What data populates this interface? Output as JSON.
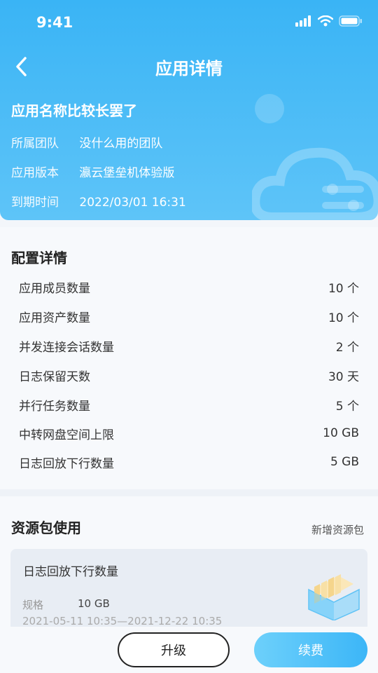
{
  "status_bar": {
    "time": "9:41"
  },
  "nav": {
    "title": "应用详情"
  },
  "app": {
    "name": "应用名称比较长罢了",
    "team_label": "所属团队",
    "team_value": "没什么用的团队",
    "version_label": "应用版本",
    "version_value": "瀛云堡垒机体验版",
    "expire_label": "到期时间",
    "expire_value": "2022/03/01 16:31"
  },
  "config": {
    "title": "配置详情",
    "rows": [
      {
        "label": "应用成员数量",
        "value": "10 个"
      },
      {
        "label": "应用资产数量",
        "value": "10 个"
      },
      {
        "label": "并发连接会话数量",
        "value": "2 个"
      },
      {
        "label": "日志保留天数",
        "value": "30 天"
      },
      {
        "label": "并行任务数量",
        "value": "5 个"
      },
      {
        "label": "中转网盘空间上限",
        "value": "10 GB"
      },
      {
        "label": "日志回放下行数量",
        "value": "5 GB"
      }
    ]
  },
  "resources": {
    "title": "资源包使用",
    "add_label": "新增资源包",
    "card": {
      "title": "日志回放下行数量",
      "spec_label": "规格",
      "spec_value": "10 GB",
      "dates": "2021-05-11 10:35—2021-12-22 10:35"
    }
  },
  "actions": {
    "upgrade_label": "升级",
    "renew_label": "续费"
  },
  "colors": {
    "accent": "#3ab4f5",
    "button_gradient_start": "#6dd0fb",
    "button_gradient_end": "#3cb6f7"
  },
  "icons": {
    "back": "chevron-left-icon",
    "signal": "signal-icon",
    "wifi": "wifi-icon",
    "battery": "battery-icon"
  }
}
